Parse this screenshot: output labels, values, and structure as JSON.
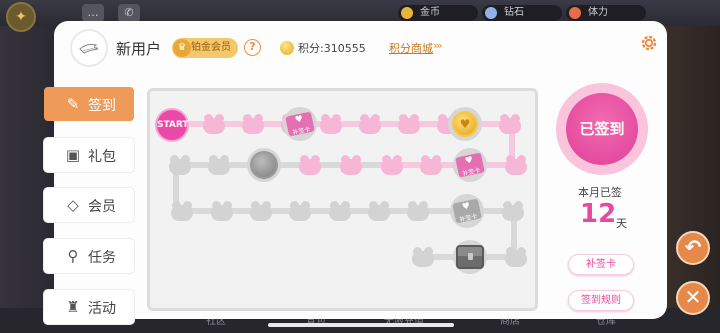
{
  "background": {
    "resources": [
      {
        "label": "金币",
        "icon": "coin-icon",
        "color": "#e9b43a"
      },
      {
        "label": "钻石",
        "icon": "diamond-icon",
        "color": "#8fb2e8"
      },
      {
        "label": "体力",
        "icon": "stamina-icon",
        "color": "#e96b4a"
      }
    ],
    "bottom_tabs": [
      "社区",
      "背包",
      "无限充值",
      "商店",
      "仓库"
    ]
  },
  "header": {
    "username": "新用户",
    "vip_label": "铂金会员",
    "help_symbol": "?",
    "points_text": "积分:310555",
    "shop_link": "积分商城",
    "shop_arrows": "›››"
  },
  "menu": [
    {
      "label": "签到",
      "icon": "brush-icon",
      "glyph": "✎",
      "active": true
    },
    {
      "label": "礼包",
      "icon": "gift-icon",
      "glyph": "🎁",
      "active": false
    },
    {
      "label": "会员",
      "icon": "diamond-icon",
      "glyph": "◇",
      "active": false
    },
    {
      "label": "任务",
      "icon": "location-pin-icon",
      "glyph": "⬤",
      "active": false
    },
    {
      "label": "活动",
      "icon": "activity-icon",
      "glyph": "♜",
      "active": false
    }
  ],
  "board": {
    "start_label": "START",
    "card_label": "补签卡",
    "coin_symbol": "♥",
    "checked_days": 12
  },
  "status": {
    "signed_label": "已签到",
    "month_label": "本月已签",
    "days": "12",
    "days_unit": "天",
    "makeup_card_button": "补签卡",
    "rules_button": "签到规则"
  },
  "colors": {
    "accent_orange": "#ee9a58",
    "accent_pink": "#e64a9f",
    "track_pink": "#f7c9e0",
    "track_grey": "#d9d9d9"
  }
}
